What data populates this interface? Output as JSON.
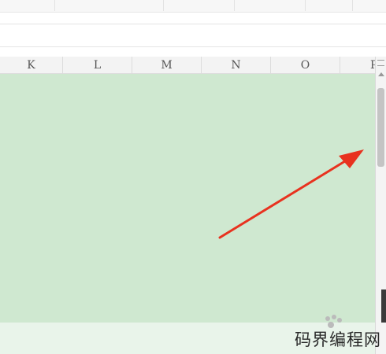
{
  "columns": [
    "K",
    "L",
    "M",
    "N",
    "O",
    "P"
  ],
  "watermark": {
    "text": "码界编程网"
  },
  "colors": {
    "grid_fill": "#cfe8d0",
    "arrow": "#e8321f"
  }
}
